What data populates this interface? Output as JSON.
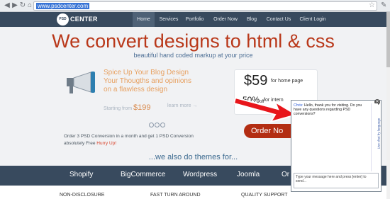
{
  "browser": {
    "url": "www.psdcenter.com",
    "back_icon": "back-arrow-icon",
    "forward_icon": "forward-arrow-icon",
    "reload_icon": "reload-icon",
    "home_icon": "home-icon"
  },
  "header": {
    "logo_mark": "PSD",
    "logo_word": "CENTER",
    "menu": [
      "Home",
      "Services",
      "Portfolio",
      "Order Now",
      "Blog",
      "Contact Us",
      "Client Login"
    ],
    "active": "Home"
  },
  "hero": {
    "headline": "We convert designs to html & css",
    "subhead": "beautiful hand coded markup at your price",
    "blurb_lines": [
      "Spice Up Your Blog Design",
      "Your Thougths and opinions",
      "on a flawless design"
    ],
    "starting_label": "Starting from",
    "starting_price": "$199",
    "learn_more": "learn more →",
    "order_text_1": "Order 3 PSD Conversion in a month and get 1 PSD Conversion",
    "order_text_2": "absolutely Free",
    "hurry": "Hurry Up!"
  },
  "pricing": {
    "price": "$59",
    "price_label": "for home page",
    "percent": "50%",
    "percent_suffix": "off",
    "intl_label": "for intern",
    "order_button": "Order No"
  },
  "themes": {
    "heading": "...we also do themes for...",
    "items": [
      "Shopify",
      "BigCommerce",
      "Wordpress",
      "Joomla",
      "Or"
    ]
  },
  "features": [
    "NON-DISCLOSURE",
    "FAST TURN AROUND",
    "QUALITY SUPPORT"
  ],
  "chat": {
    "agent_name": "Chris:",
    "message": "Hello, thank you for visiting. Do you have any questions regarding PSD conversions?",
    "side_label": "Live chat by language",
    "input_placeholder": "Type your message here and press [enter] to send..."
  },
  "colors": {
    "accent": "#b9381a",
    "header": "#384a5e",
    "link": "#4d6f95"
  }
}
